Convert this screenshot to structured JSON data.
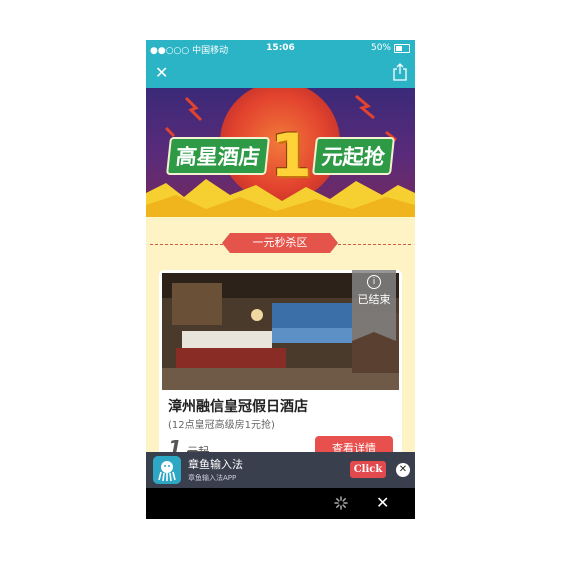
{
  "status_bar": {
    "carrier": "●●○○○ 中国移动",
    "time": "15:06",
    "battery": "50%"
  },
  "nav": {
    "close_icon": "close-icon",
    "share_icon": "share-icon"
  },
  "banner": {
    "title_left": "高星酒店",
    "title_number": "1",
    "title_right": "元起抢"
  },
  "section": {
    "title": "一元秒杀区"
  },
  "deal": {
    "status_badge": "已结束",
    "hotel_name": "漳州融信皇冠假日酒店",
    "subtitle": "(12点皇冠高级房1元抢)",
    "price_number": "1",
    "price_unit": "元起",
    "detail_button": "查看详情"
  },
  "ad": {
    "title": "章鱼输入法",
    "subtitle": "章鱼输入法APP",
    "click_label": "Click",
    "close_label": "✕"
  },
  "bottom_bar": {
    "close_label": "✕"
  },
  "colors": {
    "nav": "#2ab4c6",
    "ribbon": "#e4544a",
    "button": "#e8504d",
    "background": "#fdf3c4"
  }
}
